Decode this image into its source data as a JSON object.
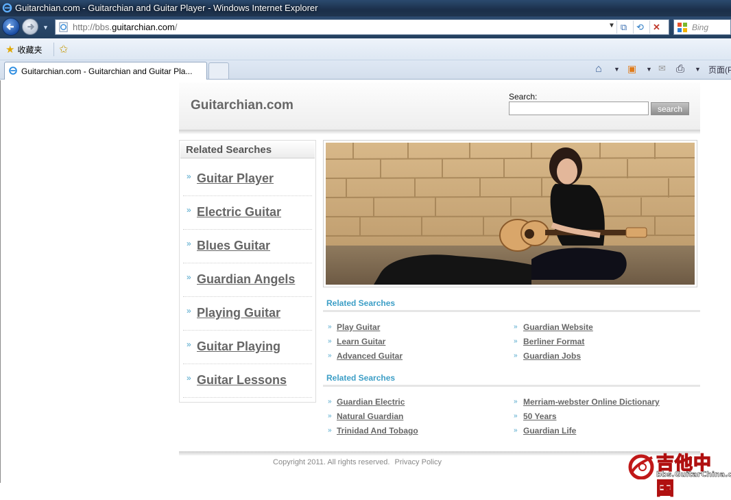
{
  "browser": {
    "window_title": "Guitarchian.com - Guitarchian and Guitar Player - Windows Internet Explorer",
    "url_prefix": "http://bbs.",
    "url_domain": "guitarchian.com",
    "url_suffix": "/",
    "search_engine": "Bing",
    "favorites_label": "收藏夹",
    "tab_title": "Guitarchian.com - Guitarchian and Guitar Pla...",
    "page_menu": "页面(P"
  },
  "header": {
    "site_title": "Guitarchian.com",
    "search_label": "Search:",
    "search_value": "",
    "search_button": "search"
  },
  "sidebar": {
    "title": "Related Searches",
    "items": [
      {
        "label": "Guitar Player"
      },
      {
        "label": "Electric Guitar"
      },
      {
        "label": "Blues Guitar"
      },
      {
        "label": "Guardian Angels"
      },
      {
        "label": "Playing Guitar"
      },
      {
        "label": "Guitar Playing"
      },
      {
        "label": "Guitar Lessons"
      }
    ]
  },
  "related_blocks": [
    {
      "title": "Related Searches",
      "left": [
        "Play Guitar",
        "Learn Guitar",
        "Advanced Guitar"
      ],
      "right": [
        "Guardian Website",
        "Berliner Format",
        "Guardian Jobs"
      ]
    },
    {
      "title": "Related Searches",
      "left": [
        "Guardian Electric",
        "Natural Guardian",
        "Trinidad And Tobago"
      ],
      "right": [
        "Merriam-webster Online Dictionary",
        "50 Years",
        "Guardian Life"
      ]
    }
  ],
  "footer": {
    "copyright": "Copyright 2011. All rights reserved.",
    "privacy": "Privacy Policy"
  },
  "watermark": {
    "chinese": "吉他中国",
    "url": "bbs.GuitarChina.com"
  },
  "colors": {
    "accent": "#3c9ec6",
    "link": "#666666",
    "titlebar": "#1b2f4a"
  }
}
